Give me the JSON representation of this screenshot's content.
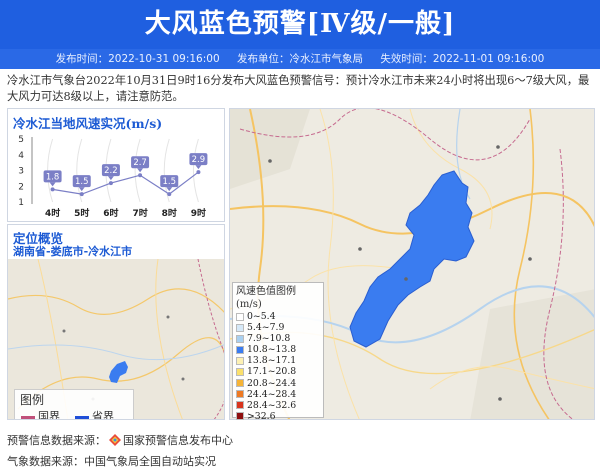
{
  "header": {
    "title": "大风蓝色预警[Ⅳ级/一般]"
  },
  "infobar": {
    "publish_time": "发布时间：2022-10-31 09:16:00",
    "publisher": "发布单位：冷水江市气象局",
    "expire_time": "失效时间：2022-11-01 09:16:00"
  },
  "description": "冷水江市气象台2022年10月31日9时16分发布大风蓝色预警信号：预计冷水江市未来24小时将出现6～7级大风，最大风力可达8级以上，请注意防范。",
  "wind_panel": {
    "title": "冷水江当地风速实况(m/s)"
  },
  "chart_data": {
    "type": "line",
    "categories": [
      "4时",
      "5时",
      "6时",
      "7时",
      "8时",
      "9时"
    ],
    "values": [
      1.8,
      1.5,
      2.2,
      2.7,
      1.5,
      2.9
    ],
    "title": "冷水江当地风速实况(m/s)",
    "ylim": [
      1,
      5
    ],
    "yticks": [
      "1",
      "2",
      "3",
      "4",
      "5"
    ],
    "grid": false,
    "marker_color": "#7b7fc6"
  },
  "location_panel": {
    "title": "定位概览",
    "path": "湖南省-娄底市-冷水江市",
    "map_legend": {
      "title": "图例",
      "items": [
        {
          "label": "国界",
          "color": "#c0507a"
        },
        {
          "label": "省界",
          "color": "#1f4fd8"
        }
      ]
    }
  },
  "speed_legend": {
    "title": "风速色值图例 (m/s)",
    "items": [
      {
        "label": "0~5.4",
        "color": "#ffffff"
      },
      {
        "label": "5.4~7.9",
        "color": "#d6e9f8"
      },
      {
        "label": "7.9~10.8",
        "color": "#a9d0f0"
      },
      {
        "label": "10.8~13.8",
        "color": "#3a7cf0"
      },
      {
        "label": "13.8~17.1",
        "color": "#fdf1b3"
      },
      {
        "label": "17.1~20.8",
        "color": "#fbe06b"
      },
      {
        "label": "20.8~24.4",
        "color": "#f6b436"
      },
      {
        "label": "24.4~28.4",
        "color": "#ee7a22"
      },
      {
        "label": "28.4~32.6",
        "color": "#d8341c"
      },
      {
        "label": ">32.6",
        "color": "#8e0e0e"
      }
    ]
  },
  "footer": {
    "warning_source": "预警信息数据来源：",
    "warning_source_name": "国家预警信息发布中心",
    "weather_source": "气象数据来源：中国气象局全国自动站实况"
  },
  "colors": {
    "primary": "#1f5fe0",
    "warning_area": "#3a7cf0"
  }
}
